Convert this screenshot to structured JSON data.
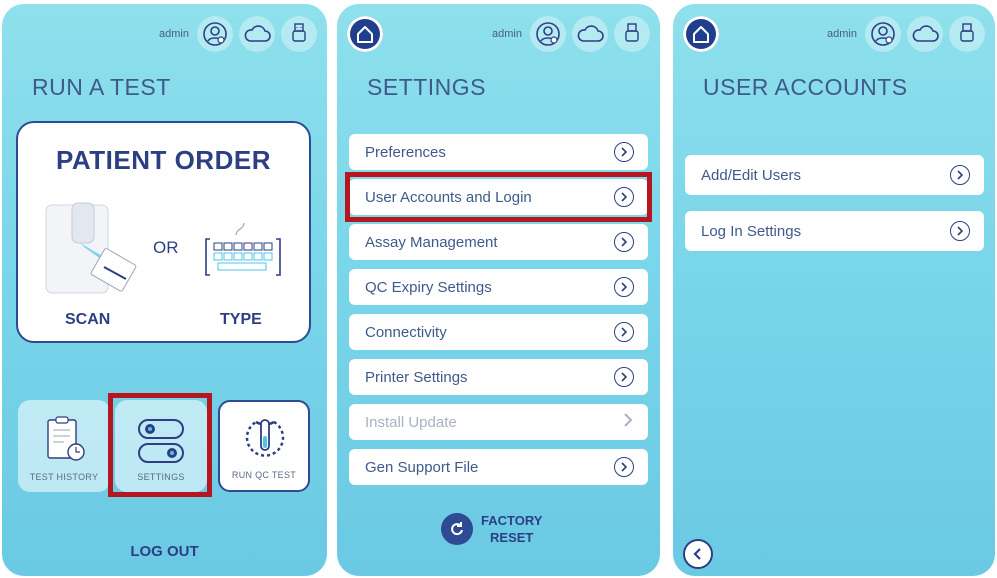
{
  "common": {
    "admin_label": "admin"
  },
  "screen1": {
    "title": "RUN A TEST",
    "card_title": "PATIENT ORDER",
    "or_text": "OR",
    "scan_label": "SCAN",
    "type_label": "TYPE",
    "tiles": {
      "history": "TEST HISTORY",
      "settings": "SETTINGS",
      "qc": "RUN QC TEST"
    },
    "logout": "LOG OUT"
  },
  "screen2": {
    "title": "SETTINGS",
    "items": [
      {
        "label": "Preferences",
        "enabled": true
      },
      {
        "label": "User Accounts and Login",
        "enabled": true,
        "highlighted": true
      },
      {
        "label": "Assay Management",
        "enabled": true
      },
      {
        "label": "QC Expiry Settings",
        "enabled": true
      },
      {
        "label": "Connectivity",
        "enabled": true
      },
      {
        "label": "Printer Settings",
        "enabled": true
      },
      {
        "label": "Install Update",
        "enabled": false
      },
      {
        "label": "Gen Support File",
        "enabled": true
      }
    ],
    "factory_line1": "FACTORY",
    "factory_line2": "RESET"
  },
  "screen3": {
    "title": "USER ACCOUNTS",
    "items": [
      {
        "label": "Add/Edit Users"
      },
      {
        "label": "Log In Settings"
      }
    ]
  },
  "colors": {
    "navy": "#2d3f83",
    "highlight": "#b5161f",
    "background_top": "#8fe0ec",
    "background_bottom": "#6ac9e3"
  },
  "icons": [
    "user-settings-icon",
    "cloud-icon",
    "usb-icon",
    "home-icon",
    "chevron-right-circle-icon",
    "back-icon",
    "reset-icon",
    "clipboard-clock-icon",
    "toggle-switch-icon",
    "test-tube-icon",
    "scanner-icon",
    "keyboard-icon"
  ]
}
